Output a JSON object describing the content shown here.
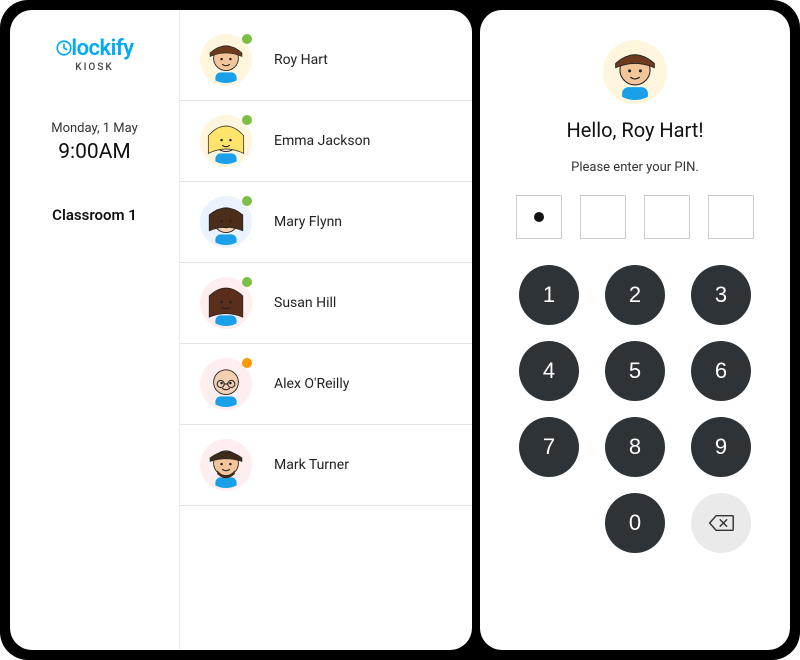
{
  "brand": {
    "name": "lockify",
    "sub_label": "KIOSK"
  },
  "date": "Monday, 1 May",
  "time": "9:00AM",
  "location": "Classroom 1",
  "users": [
    {
      "name": "Roy Hart",
      "status": "green",
      "avatar_bg": "#fff6dd",
      "avatar_kind": "roy"
    },
    {
      "name": "Emma Jackson",
      "status": "green",
      "avatar_bg": "#fff6dd",
      "avatar_kind": "emma"
    },
    {
      "name": "Mary Flynn",
      "status": "green",
      "avatar_bg": "#eaf3ff",
      "avatar_kind": "mary"
    },
    {
      "name": "Susan Hill",
      "status": "green",
      "avatar_bg": "#ffeef0",
      "avatar_kind": "susan"
    },
    {
      "name": "Alex O'Reilly",
      "status": "orange",
      "avatar_bg": "#ffeef0",
      "avatar_kind": "alex"
    },
    {
      "name": "Mark Turner",
      "status": "",
      "avatar_bg": "#ffeef0",
      "avatar_kind": "mark"
    }
  ],
  "pin_screen": {
    "avatar_bg": "#fff6dd",
    "avatar_kind": "roy",
    "greeting": "Hello, Roy Hart!",
    "instruction": "Please enter your PIN.",
    "filled_digits": 1,
    "total_digits": 4,
    "keys": [
      "1",
      "2",
      "3",
      "4",
      "5",
      "6",
      "7",
      "8",
      "9",
      "0"
    ]
  },
  "colors": {
    "accent": "#03a9f4",
    "key_bg": "#2d3336",
    "status_green": "#7bc043",
    "status_orange": "#ff9800"
  }
}
